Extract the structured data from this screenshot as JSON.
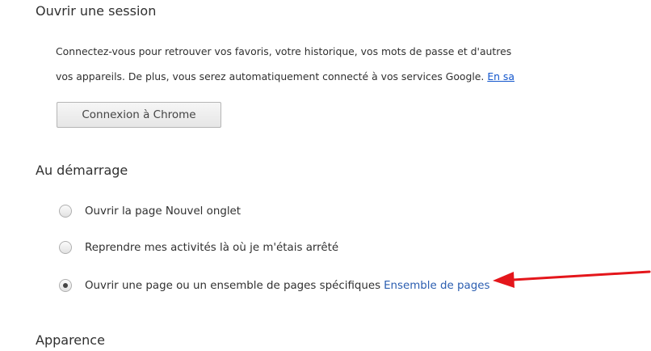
{
  "signin": {
    "title": "Ouvrir une session",
    "description_line1": "Connectez-vous pour retrouver vos favoris, votre historique, vos mots de passe et d'autres",
    "description_line2": "vos appareils. De plus, vous serez automatiquement connecté à vos services Google.",
    "learn_more_link": "En sa",
    "button_label": "Connexion à Chrome"
  },
  "startup": {
    "title": "Au démarrage",
    "options": [
      {
        "label": "Ouvrir la page Nouvel onglet",
        "selected": false
      },
      {
        "label": "Reprendre mes activités là où je m'étais arrêté",
        "selected": false
      },
      {
        "label": "Ouvrir une page ou un ensemble de pages spécifiques",
        "selected": true,
        "link": "Ensemble de pages"
      }
    ]
  },
  "appearance": {
    "title": "Apparence"
  },
  "annotation": {
    "arrow_color": "#e4161b"
  },
  "colors": {
    "link": "#1155cc",
    "text": "#303030"
  }
}
